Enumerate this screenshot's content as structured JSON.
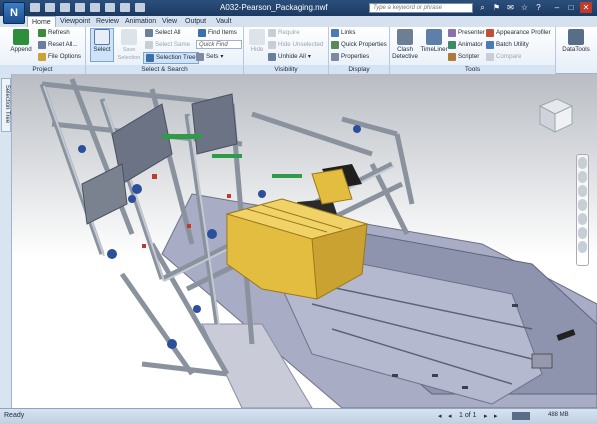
{
  "window": {
    "title": "A032-Pearson_Packaging.nwf",
    "app_letter": "N"
  },
  "search": {
    "placeholder": "Type a keyword or phrase"
  },
  "tabs": [
    "Home",
    "Viewpoint",
    "Review",
    "Animation",
    "View",
    "Output",
    "Vault"
  ],
  "ribbon": {
    "project": {
      "title": "Project",
      "append": "Append",
      "refresh": "Refresh",
      "reset_all": "Reset All...",
      "file_options": "File Options"
    },
    "select_search": {
      "title": "Select & Search",
      "select": "Select",
      "save_selection": "Save Selection",
      "select_all": "Select All",
      "select_same": "Select Same",
      "selection_tree": "Selection Tree",
      "find_items": "Find Items",
      "quick_find": "Quick Find",
      "sets": "Sets"
    },
    "visibility": {
      "title": "Visibility",
      "hide": "Hide",
      "require": "Require",
      "hide_unselected": "Hide Unselected",
      "unhide_all": "Unhide All"
    },
    "display": {
      "title": "Display",
      "links": "Links",
      "quick_properties": "Quick Properties",
      "properties": "Properties"
    },
    "tools": {
      "title": "Tools",
      "clash_detective": "Clash Detective",
      "timeliner": "TimeLiner",
      "presenter": "Presenter",
      "animator": "Animator",
      "scripter": "Scripter",
      "appearance_profiler": "Appearance Profiler",
      "batch_utility": "Batch Utility",
      "compare": "Compare"
    },
    "datatools": "DataTools"
  },
  "side_tab": "Selection Tree",
  "status": {
    "left": "Ready",
    "page": "1 of 1",
    "memory": "488 MB"
  },
  "colors": {
    "accent": "#1c4d8e",
    "yellow_product": "#e3bd3f",
    "frame": "#a8b0bb",
    "conveyor": "#9aa0b8"
  }
}
